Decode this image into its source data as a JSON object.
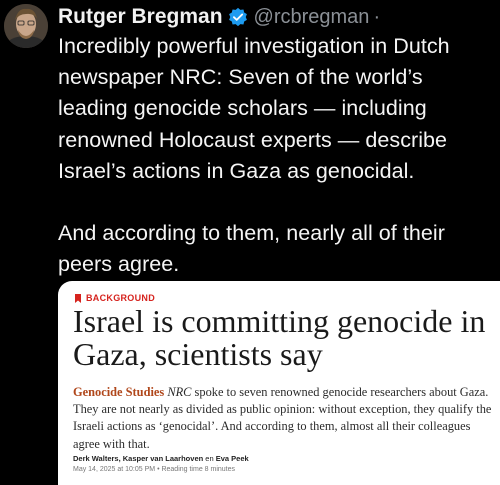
{
  "author": {
    "name": "Rutger Bregman",
    "handle": "@rcbregman",
    "separator": "·"
  },
  "tweet": {
    "paragraph1": "Incredibly powerful investigation in Dutch newspaper NRC: Seven of the world’s leading genocide scholars — including renowned Holocaust experts — describe Israel’s actions in Gaza as genocidal.",
    "paragraph2": "And according to them, nearly all of their peers agree."
  },
  "article": {
    "kicker": "BACKGROUND",
    "headline": "Israel is committing genocide in Gaza, scientists say",
    "lead_brand": "Genocide Studies",
    "lead_nrc": "NRC",
    "lead_text": "spoke to seven renowned genocide researchers about Gaza. They are not nearly as divided as public opinion: without exception, they qualify the Israeli actions as ‘genocidal’. And according to them, almost all their colleagues agree with that.",
    "author1": "Derk Walters, Kasper van Laarhoven",
    "author_join": "en",
    "author2": "Eva Peek",
    "date": "May 14, 2025 at 10:05 PM",
    "meta_separator": "•",
    "reading_time": "Reading time 8 minutes"
  },
  "colors": {
    "background": "#000000",
    "verified_blue": "#1d9bf0",
    "kicker_red": "#d6231e",
    "brand_orange": "#b0471b"
  },
  "icons": [
    "avatar",
    "verified-badge-icon",
    "bookmark-icon"
  ]
}
